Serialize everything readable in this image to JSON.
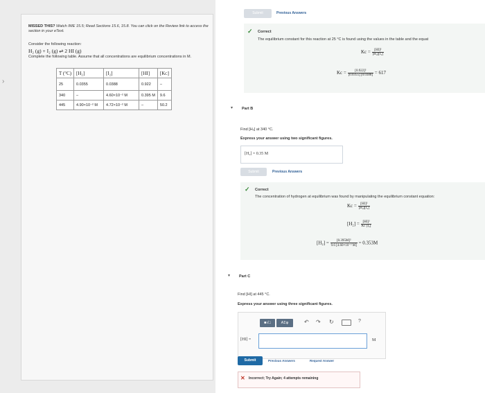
{
  "left_panel": {
    "missed_prefix": "MISSED THIS?",
    "missed_text": "Watch IWE 15.5; Read Sections 15.6, 15.8. You can click on the Review link to access the section in your eText.",
    "reaction_intro": "Consider the following reaction:",
    "reaction": "H₂ (g) + I₂ (g) ⇌ 2 HI (g)",
    "table_intro": "Complete the following table. Assume that all concentrations are equilibrium concentrations in M.",
    "table_headers": [
      "T (°C)",
      "[H₂]",
      "[I₂]",
      "[HI]",
      "[Kᴄ]"
    ],
    "table_rows": [
      [
        "25",
        "0.0355",
        "0.0388",
        "0.922",
        "–"
      ],
      [
        "340",
        "–",
        "4.60×10⁻² M",
        "0.395 M",
        "9.6"
      ],
      [
        "445",
        "4.90×10⁻² M",
        "4.72×10⁻² M",
        "–",
        "50.2"
      ]
    ]
  },
  "part_a": {
    "submit_label": "Submit",
    "previous_answers": "Previous Answers",
    "correct_label": "Correct",
    "explanation": "The equilibrium constant for this reaction at 25 °C is found using the values in the table and the equat",
    "kc_lhs": "Kc =",
    "kc_num": "[HI]²",
    "kc_den": "[H₂][I₂]",
    "kc2_num": "[0.922]²",
    "kc2_den": "[0.0355] [0.0388]",
    "kc2_result": "= 617"
  },
  "part_b": {
    "title": "Part B",
    "question": "Find [H₂] at 340 °C.",
    "instruction": "Express your answer using two significant figures.",
    "answer": "[H₂] = 0.35  M",
    "submit_label": "Submit",
    "previous_answers": "Previous Answers",
    "correct_label": "Correct",
    "explanation": "The concentration of hydrogen at equilibrium was found by manipulating the equilibrium constant equation:",
    "eq1_lhs": "Kc =",
    "eq1_num": "[HI]²",
    "eq1_den": "[H₂][I₂]",
    "eq2_lhs": "[H₂] =",
    "eq2_num": "[HI]²",
    "eq2_den": "Kc [I₂]",
    "eq3_lhs": "[H₂] =",
    "eq3_num": "[0.395M]²",
    "eq3_den": "9.6 [4.60×10⁻² M]",
    "eq3_result": "= 0.353M"
  },
  "part_c": {
    "title": "Part C",
    "question": "Find [HI] at 445 °C.",
    "instruction": "Express your answer using three significant figures.",
    "toolbar_templates": "■√□",
    "toolbar_greek": "AΣφ",
    "answer_label": "[HI] =",
    "answer_value": "",
    "unit": "M",
    "submit_label": "Submit",
    "previous_answers": "Previous Answers",
    "request_answer": "Request Answer",
    "feedback": "Incorrect; Try Again; 4 attempts remaining"
  },
  "side_arrow": "›"
}
